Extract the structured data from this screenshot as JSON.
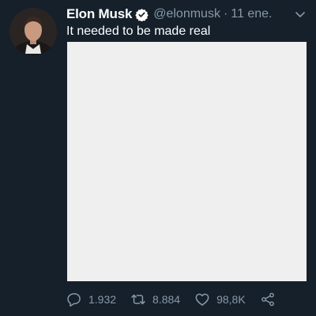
{
  "tweet": {
    "author": {
      "name": "Elon Musk",
      "handle": "@elonmusk",
      "avatar_icon": "profile-photo"
    },
    "separator": "·",
    "date": "11 ene.",
    "text": "It needed to be made real",
    "media": {
      "background": "#efefef"
    },
    "actions": {
      "replies": "1.932",
      "retweets": "8.884",
      "likes": "98,8K"
    }
  },
  "colors": {
    "background": "#15202b",
    "muted_text": "#8899a6",
    "verified": "#1da1f2"
  }
}
